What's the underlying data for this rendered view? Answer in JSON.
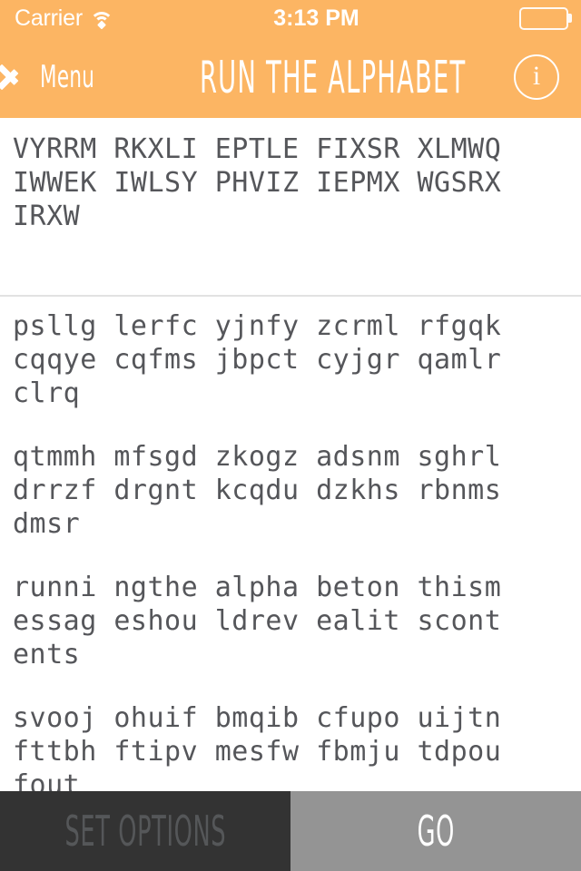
{
  "status_bar": {
    "carrier": "Carrier",
    "wifi_icon": "wifi-icon",
    "time": "3:13 PM",
    "battery_icon": "battery-icon"
  },
  "nav_bar": {
    "back_label": "Menu",
    "back_icon": "chevron-left-icon",
    "title": "RUN THE ALPHABET",
    "info_icon": "info-icon",
    "info_glyph": "i",
    "background_color": "#fcb563"
  },
  "content": {
    "cipher_text": "VYRRM RKXLI EPTLE FIXSR XLMWQ IWWEK IWLSY PHVIZ IEPMX WGSRX IRXW",
    "results": [
      "psllg lerfc yjnfy zcrml rfgqk cqqye cqfms jbpct cyjgr qamlr clrq",
      "qtmmh mfsgd zkogz adsnm sghrl drrzf drgnt kcqdu dzkhs rbnms dmsr",
      "runni ngthe alpha beton thism essag eshou ldrev ealit scont ents",
      "svooj ohuif bmqib cfupo uijtn fttbh ftipv mesfw fbmju tdpou fout"
    ],
    "text_color": "#55565a",
    "divider_color": "#e2e2e2"
  },
  "toolbar": {
    "set_options_label": "SET OPTIONS",
    "go_label": "GO",
    "set_options_bg": "#333333",
    "go_bg": "#949494"
  }
}
